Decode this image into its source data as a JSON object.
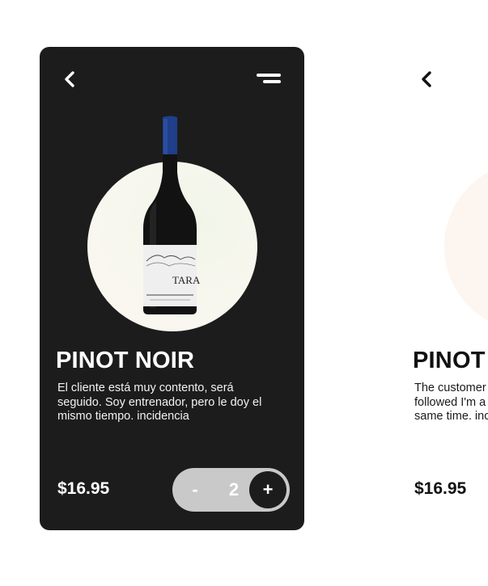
{
  "product_card_dark": {
    "title": "PINOT NOIR",
    "description": "El cliente está muy contento, será seguido. Soy entrenador, pero le doy el mismo tiempo. incidencia",
    "price": "$16.95",
    "stepper": {
      "minus_label": "-",
      "quantity": "2",
      "plus_label": "+"
    },
    "bottle_label_text": "TARA",
    "icons": {
      "back": "chevron-left-icon",
      "menu": "menu-icon"
    },
    "colors": {
      "card_bg": "#1c1c1c",
      "stepper_bg": "#c9c9c9",
      "bottle_cap": "#1f3f8a"
    }
  },
  "product_card_light": {
    "title": "PINOT NOIR",
    "description": "The customer is very happy, it will be followed I'm a coach, but I'm giving it the same time. incidence",
    "price": "$16.95",
    "icons": {
      "back": "chevron-left-icon"
    },
    "colors": {
      "card_bg": "#ffffff",
      "circle": "#fdf5ef"
    }
  }
}
